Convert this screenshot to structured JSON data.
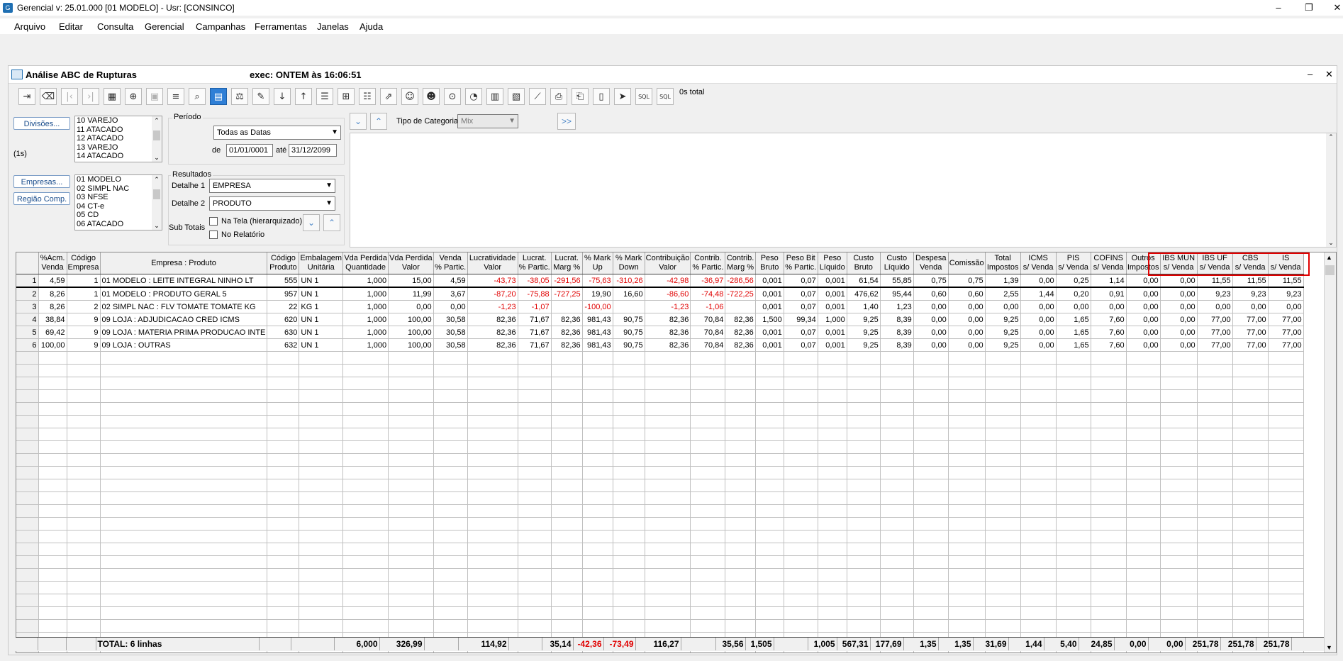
{
  "app": {
    "title": "Gerencial  v: 25.01.000  [01 MODELO] - Usr: [CONSINCO]",
    "minimize": "–",
    "restore": "❐",
    "close": "✕"
  },
  "menu": [
    {
      "label": "Arquivo"
    },
    {
      "label": "Editar"
    },
    {
      "label": "Consulta"
    },
    {
      "label": "Gerencial"
    },
    {
      "label": "Campanhas"
    },
    {
      "label": "Ferramentas"
    },
    {
      "label": "Janelas"
    },
    {
      "label": "Ajuda"
    }
  ],
  "window": {
    "title": "Análise ABC de Rupturas",
    "exec": "exec: ONTEM às 16:06:51",
    "minimize": "–",
    "close": "✕",
    "total_count": "0s total"
  },
  "toolbar_icons": [
    "exit-icon",
    "eraser-icon",
    "first-record-icon",
    "last-record-icon",
    "table-icon",
    "add-icon",
    "save-icon",
    "filter-icon",
    "search-icon",
    "calculator-icon",
    "balance-icon",
    "edit-icon",
    "sort-desc-icon",
    "sort-asc-icon",
    "checklist-icon",
    "tree-icon",
    "checklist-alt-icon",
    "export-icon",
    "user-search-icon",
    "user-refresh-icon",
    "zoom-icon",
    "pie-chart-icon",
    "bar-chart-icon",
    "bar-chart-alt-icon",
    "line-chart-icon",
    "print-icon",
    "print-preview-icon",
    "document-icon",
    "send-icon",
    "sql-icon",
    "sql-alt-icon"
  ],
  "filters": {
    "divisoes_button": "Divisões...",
    "divisoes_timing": "(1s)",
    "divisoes": [
      "10 VAREJO",
      "11 ATACADO",
      "12 ATACADO",
      "13 VAREJO",
      "14 ATACADO"
    ],
    "empresas_button": "Empresas...",
    "regiao_button": "Região Comp.",
    "empresas": [
      "01 MODELO",
      "02 SIMPL NAC",
      "03 NFSE",
      "04 CT-e",
      "05 CD",
      "06 ATACADO"
    ],
    "periodo_label": "Período",
    "periodo_value": "Todas as Datas",
    "de_label": "de",
    "de_value": "01/01/0001",
    "ate_label": "até",
    "ate_value": "31/12/2099",
    "resultados_label": "Resultados",
    "detalhe1_label": "Detalhe 1",
    "detalhe1_value": "EMPRESA",
    "detalhe2_label": "Detalhe 2",
    "detalhe2_value": "PRODUTO",
    "subtotais_label": "Sub Totais",
    "na_tela_label": "Na Tela (hierarquizado)",
    "no_relatorio_label": "No Relatório",
    "tipo_categoria_label": "Tipo de Categoria",
    "tipo_categoria_value": "Mix",
    "more_button": ">>"
  },
  "grid": {
    "columns": [
      "",
      "%Acm.\nVenda",
      "Código\nEmpresa",
      "Empresa : Produto",
      "Código\nProduto",
      "Embalagem\nUnitária",
      "Vda Perdida\nQuantidade",
      "Vda Perdida\nValor",
      "Venda\n% Partic.",
      "Lucratividade\nValor",
      "Lucrat.\n% Partic.",
      "Lucrat.\nMarg %",
      "% Mark\nUp",
      "% Mark\nDown",
      "Contribuição\nValor",
      "Contrib.\n% Partic.",
      "Contrib.\nMarg %",
      "Peso\nBruto",
      "Peso Bit\n% Partic.",
      "Peso\nLíquido",
      "Custo\nBruto",
      "Custo\nLíquido",
      "Despesa\nVenda",
      "Comissão",
      "Total\nImpostos",
      "ICMS\ns/ Venda",
      "PIS\ns/ Venda",
      "COFINS\ns/ Venda",
      "Outros\nImpostos",
      "IBS MUN\ns/ Venda",
      "IBS UF\ns/ Venda",
      "CBS\ns/ Venda",
      "IS\ns/ Venda"
    ],
    "rows": [
      [
        "1",
        "4,59",
        "1",
        "01 MODELO : LEITE INTEGRAL NINHO LT",
        "555",
        "UN 1",
        "1,000",
        "15,00",
        "4,59",
        "-43,73",
        "-38,05",
        "-291,56",
        "-75,63",
        "-310,26",
        "-42,98",
        "-36,97",
        "-286,56",
        "0,001",
        "0,07",
        "0,001",
        "61,54",
        "55,85",
        "0,75",
        "0,75",
        "1,39",
        "0,00",
        "0,25",
        "1,14",
        "0,00",
        "0,00",
        "11,55",
        "11,55",
        "11,55"
      ],
      [
        "2",
        "8,26",
        "1",
        "01 MODELO : PRODUTO GERAL 5",
        "957",
        "UN 1",
        "1,000",
        "11,99",
        "3,67",
        "-87,20",
        "-75,88",
        "-727,25",
        "19,90",
        "16,60",
        "-86,60",
        "-74,48",
        "-722,25",
        "0,001",
        "0,07",
        "0,001",
        "476,62",
        "95,44",
        "0,60",
        "0,60",
        "2,55",
        "1,44",
        "0,20",
        "0,91",
        "0,00",
        "0,00",
        "9,23",
        "9,23",
        "9,23"
      ],
      [
        "3",
        "8,26",
        "2",
        "02 SIMPL NAC : FLV TOMATE TOMATE KG",
        "22",
        "KG 1",
        "1,000",
        "0,00",
        "0,00",
        "-1,23",
        "-1,07",
        "",
        "-100,00",
        "",
        "-1,23",
        "-1,06",
        "",
        "0,001",
        "0,07",
        "0,001",
        "1,40",
        "1,23",
        "0,00",
        "0,00",
        "0,00",
        "0,00",
        "0,00",
        "0,00",
        "0,00",
        "0,00",
        "0,00",
        "0,00",
        "0,00"
      ],
      [
        "4",
        "38,84",
        "9",
        "09 LOJA : ADJUDICACAO CRED ICMS",
        "620",
        "UN 1",
        "1,000",
        "100,00",
        "30,58",
        "82,36",
        "71,67",
        "82,36",
        "981,43",
        "90,75",
        "82,36",
        "70,84",
        "82,36",
        "1,500",
        "99,34",
        "1,000",
        "9,25",
        "8,39",
        "0,00",
        "0,00",
        "9,25",
        "0,00",
        "1,65",
        "7,60",
        "0,00",
        "0,00",
        "77,00",
        "77,00",
        "77,00"
      ],
      [
        "5",
        "69,42",
        "9",
        "09 LOJA : MATERIA PRIMA PRODUCAO INTE",
        "630",
        "UN 1",
        "1,000",
        "100,00",
        "30,58",
        "82,36",
        "71,67",
        "82,36",
        "981,43",
        "90,75",
        "82,36",
        "70,84",
        "82,36",
        "0,001",
        "0,07",
        "0,001",
        "9,25",
        "8,39",
        "0,00",
        "0,00",
        "9,25",
        "0,00",
        "1,65",
        "7,60",
        "0,00",
        "0,00",
        "77,00",
        "77,00",
        "77,00"
      ],
      [
        "6",
        "100,00",
        "9",
        "09 LOJA : OUTRAS",
        "632",
        "UN 1",
        "1,000",
        "100,00",
        "30,58",
        "82,36",
        "71,67",
        "82,36",
        "981,43",
        "90,75",
        "82,36",
        "70,84",
        "82,36",
        "0,001",
        "0,07",
        "0,001",
        "9,25",
        "8,39",
        "0,00",
        "0,00",
        "9,25",
        "0,00",
        "1,65",
        "7,60",
        "0,00",
        "0,00",
        "77,00",
        "77,00",
        "77,00"
      ]
    ],
    "totals": [
      "",
      "",
      "",
      "TOTAL: 6 linhas",
      "",
      "",
      "6,000",
      "326,99",
      "",
      "114,92",
      "",
      "35,14",
      "-42,36",
      "-73,49",
      "116,27",
      "",
      "35,56",
      "1,505",
      "",
      "1,005",
      "567,31",
      "177,69",
      "1,35",
      "1,35",
      "31,69",
      "1,44",
      "5,40",
      "24,85",
      "0,00",
      "0,00",
      "251,78",
      "251,78",
      "251,78"
    ]
  },
  "colors": {
    "negative": "#e00000",
    "highlight": "#e00000",
    "active_button": "#2f7fd6"
  }
}
